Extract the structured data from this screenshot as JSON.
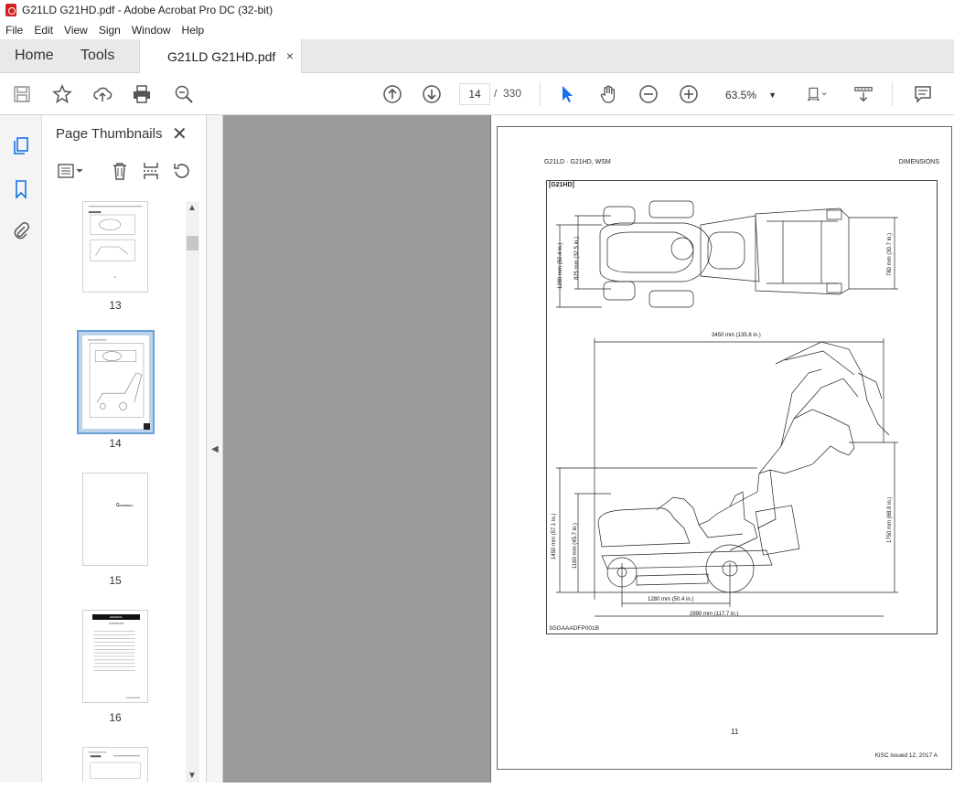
{
  "window": {
    "title": "G21LD G21HD.pdf - Adobe Acrobat Pro DC (32-bit)"
  },
  "menu": [
    "File",
    "Edit",
    "View",
    "Sign",
    "Window",
    "Help"
  ],
  "tabs": {
    "home": "Home",
    "tools": "Tools",
    "document": "G21LD G21HD.pdf",
    "close_glyph": "×"
  },
  "toolbar": {
    "current_page": "14",
    "separator": "/",
    "total_pages": "330",
    "zoom": "63.5%"
  },
  "thumbnails_panel": {
    "title": "Page Thumbnails",
    "pages": [
      {
        "label": "13",
        "selected": false
      },
      {
        "label": "14",
        "selected": true
      },
      {
        "label": "15",
        "selected": false
      },
      {
        "label": "16",
        "selected": false
      }
    ],
    "thumb15_text": "GENERAL",
    "thumb16_banner": "GENERAL",
    "thumb16_sub": "CONTENTS"
  },
  "page": {
    "header_left": "G21LD · G21HD, WSM",
    "header_right": "DIMENSIONS",
    "figure_tag": "[G21HD]",
    "figure_code": "3GGAAADFP001B",
    "page_number": "11",
    "footer": "KiSC issued 12, 2017 A",
    "dims": {
      "d1280_top": "1280 mm (50.4 in.)",
      "d825": "825 mm (32.5 in.)",
      "d780": "780 mm (30.7 in.)",
      "d3450": "3450 mm (135.8 in.)",
      "d1450": "1450 mm (57.1 in.)",
      "d1160": "1160 mm (45.7 in.)",
      "d1750": "1750 mm (68.9 in.)",
      "d1280_bottom": "1280 mm (50.4 in.)",
      "d2990": "2990 mm (117.7 in.)"
    }
  }
}
